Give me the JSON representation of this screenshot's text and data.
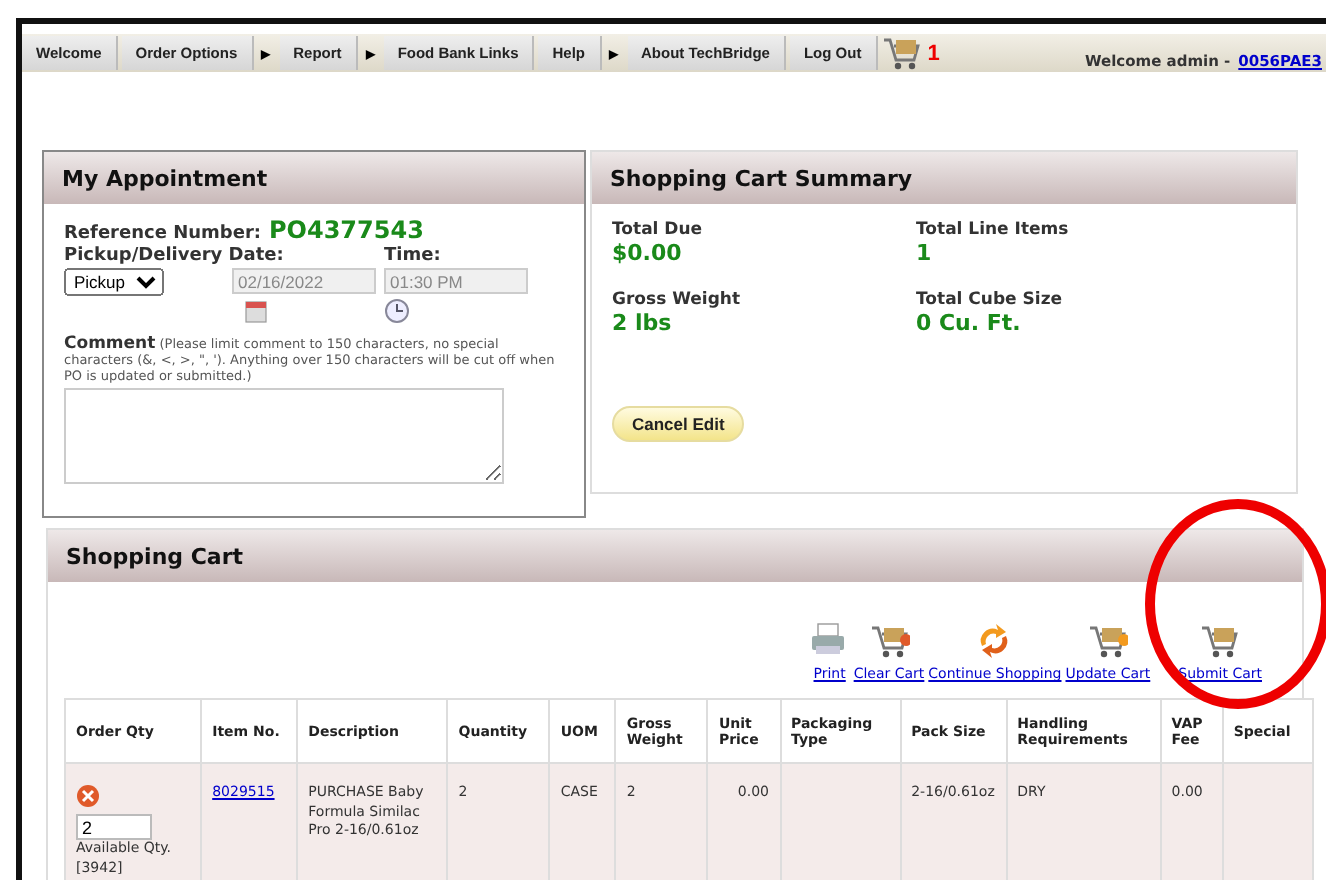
{
  "nav": {
    "items": [
      {
        "label": "Welcome",
        "has_submenu": false
      },
      {
        "label": "Order Options",
        "has_submenu": true
      },
      {
        "label": "Report",
        "has_submenu": true
      },
      {
        "label": "Food Bank Links",
        "has_submenu": false
      },
      {
        "label": "Help",
        "has_submenu": true
      },
      {
        "label": "About TechBridge",
        "has_submenu": false
      },
      {
        "label": "Log Out",
        "has_submenu": false
      }
    ],
    "submenu_mark": "▶",
    "cart_count": "1",
    "welcome": "Welcome admin -",
    "user_link": "0056PAE3"
  },
  "appointment": {
    "title": "My Appointment",
    "reference_label": "Reference Number:",
    "reference_number": "PO4377543",
    "pickup_label": "Pickup/Delivery Date:",
    "time_label": "Time:",
    "pickup_value": "Pickup",
    "date_value": "02/16/2022",
    "time_value": "01:30 PM",
    "comment_label": "Comment",
    "comment_note": "(Please limit comment to 150 characters, no special characters (&, <, >, \", '). Anything over 150 characters will be cut off when PO is updated or submitted.)"
  },
  "summary": {
    "title": "Shopping Cart Summary",
    "stats": [
      {
        "label": "Total Due",
        "value": "$0.00"
      },
      {
        "label": "Total Line Items",
        "value": "1"
      },
      {
        "label": "Gross Weight",
        "value": "2 lbs"
      },
      {
        "label": "Total Cube Size",
        "value": "0 Cu. Ft."
      }
    ],
    "cancel_button": "Cancel Edit"
  },
  "cart": {
    "title": "Shopping Cart",
    "actions": [
      {
        "label": "Print",
        "kind": "print"
      },
      {
        "label": "Clear Cart",
        "kind": "clear"
      },
      {
        "label": "Continue Shopping",
        "kind": "continue"
      },
      {
        "label": "Update Cart",
        "kind": "update"
      },
      {
        "label": "Submit Cart",
        "kind": "submit"
      }
    ],
    "columns": [
      "Order Qty",
      "Item No.",
      "Description",
      "Quantity",
      "UOM",
      "Gross Weight",
      "Unit Price",
      "Packaging Type",
      "Pack Size",
      "Handling Requirements",
      "VAP Fee",
      "Special"
    ],
    "rows": [
      {
        "cells": [
          {
            "kind": "qty",
            "value": "2",
            "note": "Available Qty. [3942]"
          },
          {
            "kind": "link",
            "text": "8029515"
          },
          {
            "kind": "text",
            "text": "PURCHASE Baby Formula Similac Pro 2-16/0.61oz"
          },
          {
            "kind": "text",
            "text": "2"
          },
          {
            "kind": "text",
            "text": "CASE"
          },
          {
            "kind": "text",
            "text": "2"
          },
          {
            "kind": "text",
            "text": "0.00"
          },
          null,
          {
            "kind": "text",
            "text": "2-16/0.61oz"
          },
          {
            "kind": "text",
            "text": "DRY"
          },
          {
            "kind": "text",
            "text": "0.00"
          },
          null
        ]
      }
    ]
  }
}
